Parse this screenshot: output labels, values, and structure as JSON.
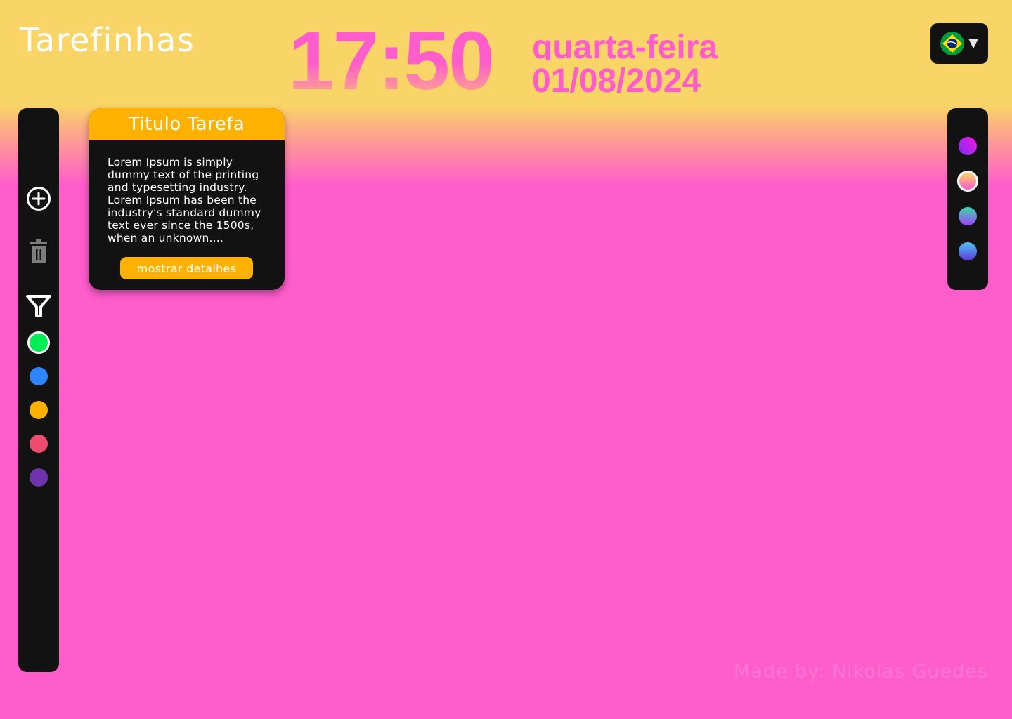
{
  "header": {
    "app_title": "Tarefinhas",
    "clock": "17:50",
    "weekday": "quarta-feira",
    "date": "01/08/2024",
    "language": {
      "icon": "brazil-flag-icon",
      "dropdown_icon": "chevron-down-icon",
      "selected": "pt-BR"
    }
  },
  "sidebar": {
    "actions": [
      {
        "icon": "add-circle-icon"
      },
      {
        "icon": "trash-icon"
      },
      {
        "icon": "filter-icon"
      }
    ],
    "color_filters": [
      {
        "name": "green",
        "color": "#00ed54",
        "selected": true
      },
      {
        "name": "blue",
        "color": "#2d86ff"
      },
      {
        "name": "orange",
        "color": "#ffb100"
      },
      {
        "name": "red",
        "color": "#ef4a6f"
      },
      {
        "name": "purple",
        "color": "#6f33b0"
      }
    ]
  },
  "themes": {
    "options": [
      {
        "name": "purple-magenta",
        "colors": [
          "#7b2ff2",
          "#f317e0"
        ]
      },
      {
        "name": "yellow-pink",
        "colors": [
          "#f9d466",
          "#ff5ccc"
        ],
        "selected": true
      },
      {
        "name": "teal-violet",
        "colors": [
          "#38d9a9",
          "#a040ff"
        ]
      },
      {
        "name": "cyan-indigo",
        "colors": [
          "#4fc3f7",
          "#5c3bd6"
        ]
      }
    ]
  },
  "task": {
    "title": "Titulo Tarefa",
    "description": "Lorem Ipsum is simply dummy text of the printing and typesetting industry. Lorem Ipsum has been the industry's standard dummy text ever since the 1500s, when an unknown....",
    "details_button": "mostrar detalhes",
    "color": "#ffb100"
  },
  "footer": {
    "credit": "Made by: Nikolas Guedes"
  }
}
